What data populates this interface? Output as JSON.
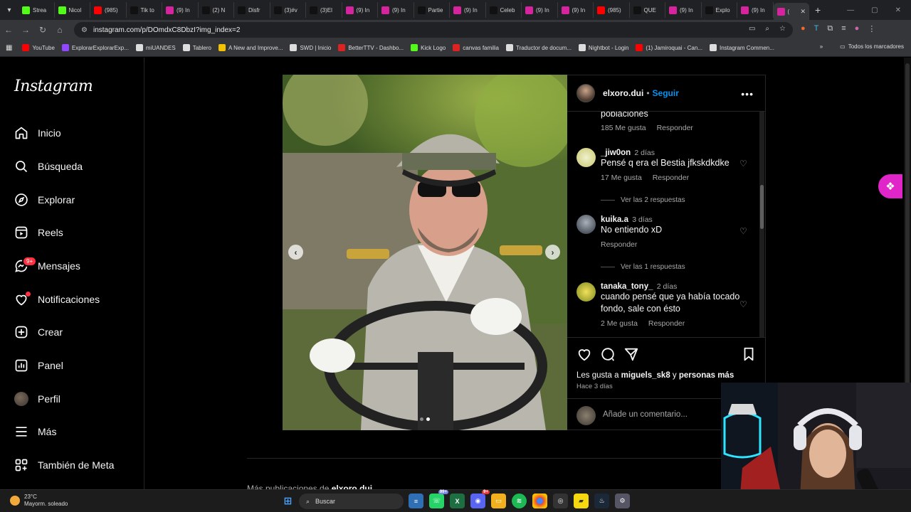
{
  "browser": {
    "tabs": [
      {
        "label": "Strea",
        "icon": "kick-icon",
        "color": "#53fc18"
      },
      {
        "label": "Nicol",
        "icon": "kick-icon",
        "color": "#53fc18"
      },
      {
        "label": "(985)",
        "icon": "youtube-icon",
        "color": "#ff0000"
      },
      {
        "label": "Tik to",
        "icon": "tiktok-icon",
        "color": "#111111"
      },
      {
        "label": "(9) In",
        "icon": "instagram-icon",
        "color": "#d6249f"
      },
      {
        "label": "(2) N",
        "icon": "x-icon",
        "color": "#111111"
      },
      {
        "label": "Disfr",
        "icon": "tiktok-icon",
        "color": "#111111"
      },
      {
        "label": "(3)#v",
        "icon": "tiktok-icon",
        "color": "#111111"
      },
      {
        "label": "(3)El",
        "icon": "tiktok-icon",
        "color": "#111111"
      },
      {
        "label": "(9) In",
        "icon": "instagram-icon",
        "color": "#d6249f"
      },
      {
        "label": "(9) In",
        "icon": "instagram-icon",
        "color": "#d6249f"
      },
      {
        "label": "Partie",
        "icon": "tiktok-icon",
        "color": "#111111"
      },
      {
        "label": "(9) In",
        "icon": "instagram-icon",
        "color": "#d6249f"
      },
      {
        "label": "Celeb",
        "icon": "tiktok-icon",
        "color": "#111111"
      },
      {
        "label": "(9) In",
        "icon": "instagram-icon",
        "color": "#d6249f"
      },
      {
        "label": "(9) In",
        "icon": "instagram-icon",
        "color": "#d6249f"
      },
      {
        "label": "(985)",
        "icon": "youtube-icon",
        "color": "#ff0000"
      },
      {
        "label": "QUE",
        "icon": "tiktok-icon",
        "color": "#111111"
      },
      {
        "label": "(9) In",
        "icon": "instagram-icon",
        "color": "#d6249f"
      },
      {
        "label": "Explo",
        "icon": "tiktok-icon",
        "color": "#111111"
      },
      {
        "label": "(9) In",
        "icon": "instagram-icon",
        "color": "#d6249f"
      },
      {
        "label": "(",
        "icon": "instagram-icon",
        "color": "#d6249f",
        "active": true
      }
    ],
    "url": "instagram.com/p/DOmdxC8DbzI?img_index=2",
    "bookmarks": [
      "YouTube",
      "ExplorarExplorarExp...",
      "miUANDES",
      "Tablero",
      "A New and Improve...",
      "SWD | Inicio",
      "BetterTTV - Dashbo...",
      "Kick Logo",
      "canvas familia",
      "Traductor de docum...",
      "Nightbot - Login",
      "(1) Jamiroquai - Can...",
      "Instagram Commen..."
    ],
    "bookmarks_all": "Todos los marcadores"
  },
  "sidebar": {
    "logo": "Instagram",
    "items": [
      {
        "label": "Inicio",
        "icon": "home-icon"
      },
      {
        "label": "Búsqueda",
        "icon": "search-icon"
      },
      {
        "label": "Explorar",
        "icon": "compass-icon"
      },
      {
        "label": "Reels",
        "icon": "reels-icon"
      },
      {
        "label": "Mensajes",
        "icon": "messenger-icon",
        "badge": "9+"
      },
      {
        "label": "Notificaciones",
        "icon": "heart-icon"
      },
      {
        "label": "Crear",
        "icon": "plus-square-icon"
      },
      {
        "label": "Panel",
        "icon": "chart-icon"
      },
      {
        "label": "Perfil",
        "icon": "avatar"
      },
      {
        "label": "Más",
        "icon": "menu-icon"
      },
      {
        "label": "También de Meta",
        "icon": "threads-icon"
      }
    ]
  },
  "post": {
    "username": "elxoro.dui",
    "separator": "•",
    "follow": "Seguir",
    "comments": [
      {
        "text": "poblaciones",
        "likes": "185 Me gusta",
        "reply": "Responder"
      },
      {
        "user": "_jiw0on",
        "time": "2 días",
        "text": "Pensé q era el Bestia jfkskdkdke",
        "likes": "17 Me gusta",
        "reply": "Responder",
        "view_replies": "Ver las 2 respuestas"
      },
      {
        "user": "kuika.a",
        "time": "3 días",
        "text": "No entiendo xD",
        "reply": "Responder",
        "view_replies": "Ver las 1 respuestas"
      },
      {
        "user": "tanaka_tony_",
        "time": "2 días",
        "text": "cuando pensé que ya había tocado fondo, sale con ésto",
        "likes": "2 Me gusta",
        "reply": "Responder"
      }
    ],
    "liked_by_prefix": "Les gusta a",
    "liked_by_user": "miguels_sk8",
    "liked_by_and": "y",
    "liked_by_others": "personas más",
    "time_ago": "Hace 3 días",
    "add_comment_placeholder": "Añade un comentario...",
    "carousel_index": 2
  },
  "more_posts": {
    "prefix": "Más publicaciones de",
    "user": "elxoro.dui"
  },
  "taskbar": {
    "temperature": "23°C",
    "weather": "Mayorm. soleado",
    "search": "Buscar",
    "whatsapp_badge": "99+",
    "discord_badge": "9+"
  }
}
